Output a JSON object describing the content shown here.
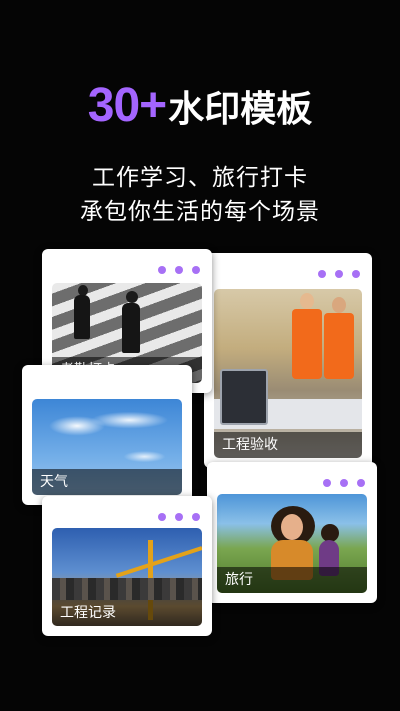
{
  "headline": {
    "number": "30+",
    "text": "水印模板"
  },
  "subtitle": {
    "line1": "工作学习、旅行打卡",
    "line2": "承包你生活的每个场景"
  },
  "cards": [
    {
      "caption": "考勤打卡"
    },
    {
      "caption": "工程验收"
    },
    {
      "caption": "天气"
    },
    {
      "caption": "旅行"
    },
    {
      "caption": "工程记录"
    }
  ],
  "colors": {
    "accent": "#a465ff",
    "background": "#050505",
    "card": "#ffffff"
  }
}
